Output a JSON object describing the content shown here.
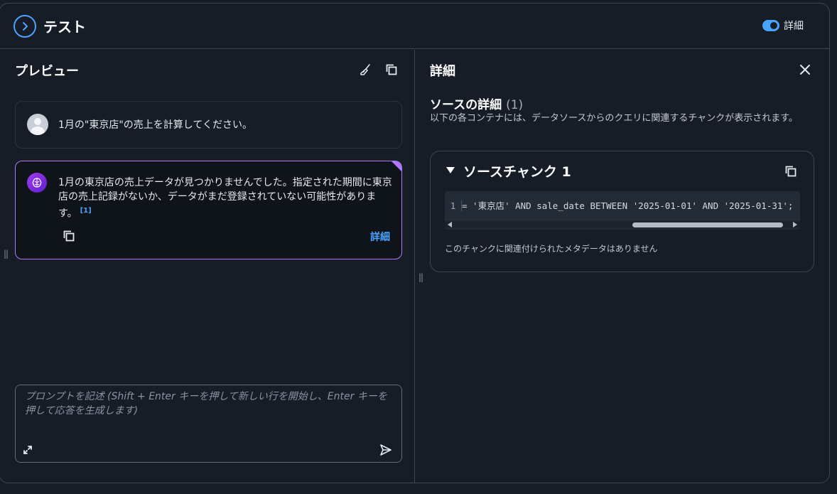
{
  "header": {
    "title": "テスト",
    "toggle_label": "詳細",
    "toggle_on": true
  },
  "preview": {
    "title": "プレビュー",
    "user_message": "1月の\"東京店\"の売上を計算してください。",
    "ai_message": "1月の東京店の売上データが見つかりませんでした。指定された期間に東京店の売上記録がないか、データがまだ登録されていない可能性があります。",
    "citation": "[1]",
    "details_link": "詳細",
    "prompt_placeholder": "プロンプトを記述 (Shift + Enter キーを押して新しい行を開始し、Enter キーを押して応答を生成します)"
  },
  "details": {
    "title": "詳細",
    "source_title": "ソースの詳細",
    "source_count": "(1)",
    "description": "以下の各コンテナには、データソースからのクエリに関連するチャンクが表示されます。",
    "chunk_title": "ソースチャンク 1",
    "code_line_number": "1",
    "code_text": "= '東京店' AND sale_date BETWEEN '2025-01-01' AND '2025-01-31';",
    "meta_note": "このチャンクに関連付けられたメタデータはありません"
  },
  "colors": {
    "accent": "#4aa3ff",
    "ai_border": "#b178ff",
    "background": "#161d27"
  }
}
